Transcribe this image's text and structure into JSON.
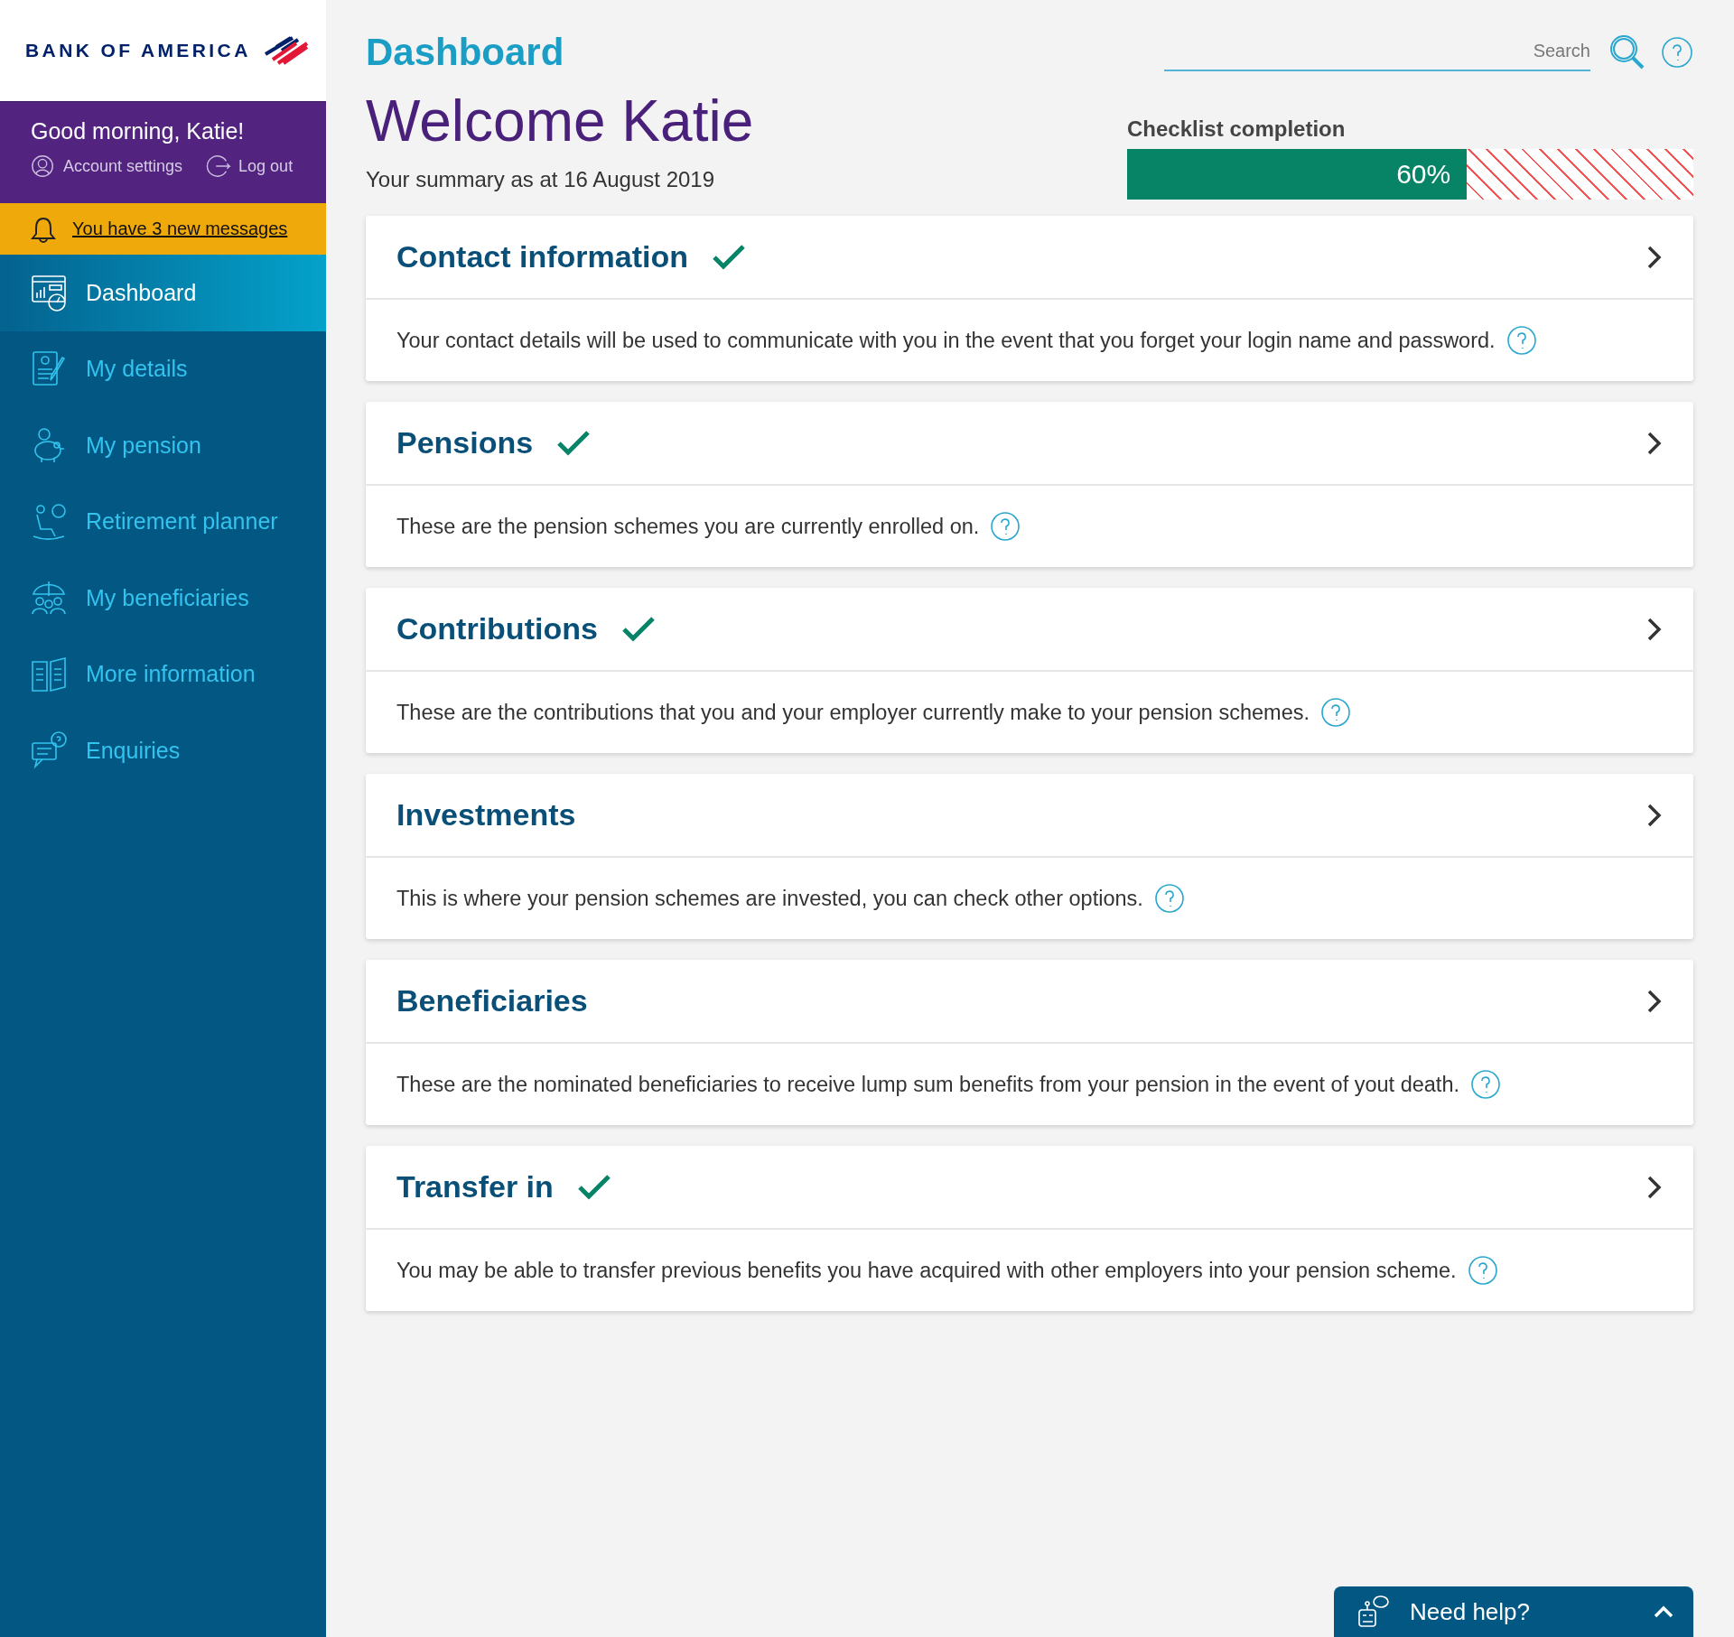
{
  "brand": {
    "logo_text": "BANK OF AMERICA"
  },
  "user_panel": {
    "greeting": "Good morning, Katie!",
    "links": [
      "Account settings",
      "Log out"
    ]
  },
  "notification": {
    "text": "You have 3 new messages"
  },
  "sidebar": {
    "items": [
      {
        "label": "Dashboard",
        "selected": true
      },
      {
        "label": "My details",
        "selected": false
      },
      {
        "label": "My pension",
        "selected": false
      },
      {
        "label": "Retirement planner",
        "selected": false
      },
      {
        "label": "My beneficiaries",
        "selected": false
      },
      {
        "label": "More information",
        "selected": false
      },
      {
        "label": "Enquiries",
        "selected": false
      }
    ]
  },
  "header": {
    "title": "Dashboard",
    "search": {
      "placeholder": "Search"
    }
  },
  "welcome": {
    "title": "Welcome Katie",
    "summary": "Your summary as at 16 August 2019"
  },
  "checklist": {
    "label": "Checklist completion",
    "level": 0.6,
    "reading": "60%"
  },
  "sections": [
    {
      "title": "Contact information",
      "completed": true,
      "description": "Your contact details will be used to communicate with you in the event that you forget your login name and password."
    },
    {
      "title": "Pensions",
      "completed": true,
      "description": "These are the pension schemes you are currently enrolled on."
    },
    {
      "title": "Contributions",
      "completed": true,
      "description": "These are the contributions that you and your employer currently make to your pension schemes."
    },
    {
      "title": "Investments",
      "completed": false,
      "description": "This is where your pension schemes are invested, you can check other options."
    },
    {
      "title": "Beneficiaries",
      "completed": false,
      "description": "These are the nominated beneficiaries to receive lump sum benefits from your pension in the event of yout death."
    },
    {
      "title": "Transfer in",
      "completed": true,
      "description": "You may be able to transfer previous benefits you have acquired with other employers into your pension scheme."
    }
  ],
  "help_widget": {
    "label": "Need help?"
  }
}
